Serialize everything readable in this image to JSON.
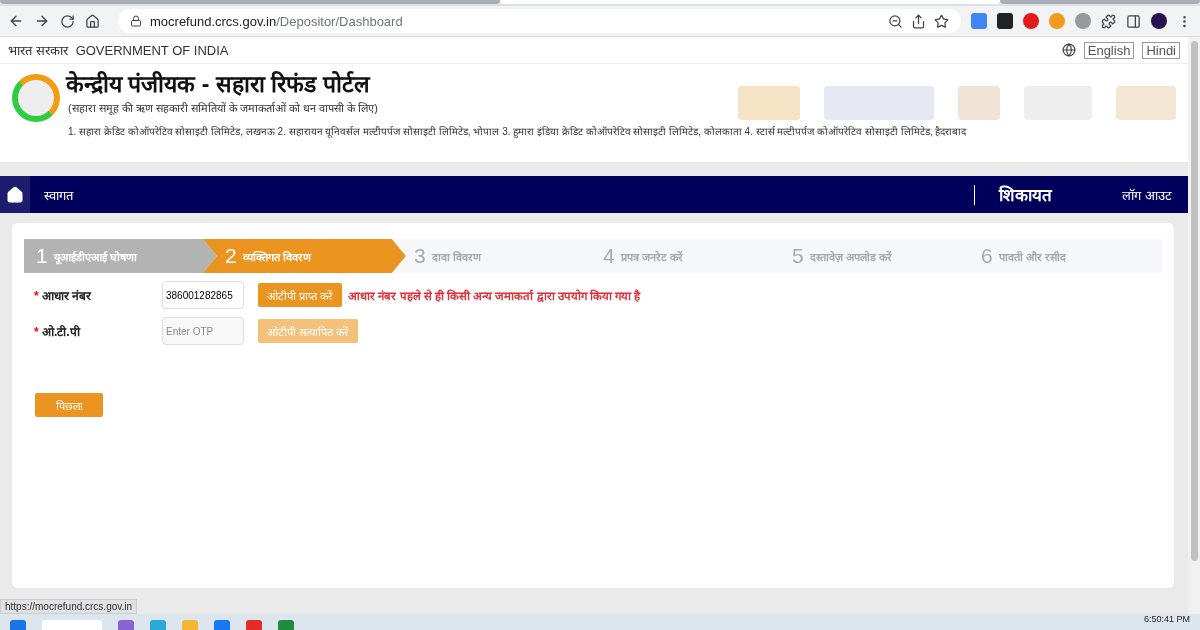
{
  "browser": {
    "url_host": "mocrefund.crcs.gov.in",
    "url_path": "/Depositor/Dashboard"
  },
  "gov_bar": {
    "hindi": "भारत सरकार",
    "english": "GOVERNMENT OF INDIA",
    "languages": [
      "English",
      "Hindi"
    ]
  },
  "header": {
    "title": "केन्द्रीय पंजीयक - सहारा रिफंड पोर्टल",
    "subtitle": "(सहारा समूह की ऋण सहकारी समितियों के जमाकर्ताओं को धन वापसी के लिए)",
    "societies": "1. सहारा क्रेडिट कोऑपरेटिव सोसाइटी लिमिटेड, लखनऊ  2. सहारायन यूनिवर्सल मल्टीपर्पज सोसाइटी लिमिटेड, भोपाल  3. हुमारा इंडिया क्रेडिट कोऑपरेटिव सोसाइटी लिमिटेड, कोलकाता  4. स्टार्स मल्टीपर्पज कोऑपरेटिव सोसाइटी लिमिटेड, हैदराबाद"
  },
  "nav": {
    "welcome": "स्वागत",
    "complaint": "शिकायत",
    "logout": "लॉग आउट"
  },
  "steps": [
    {
      "number": "1",
      "label": "यूआईडीएआई घोषणा",
      "completed": true,
      "selected": false
    },
    {
      "number": "2",
      "label": "व्यक्तिगत विवरण",
      "completed": false,
      "selected": true
    },
    {
      "number": "3",
      "label": "दावा विवरण",
      "completed": false,
      "selected": false
    },
    {
      "number": "4",
      "label": "प्रपत्र जनरेट करें",
      "completed": false,
      "selected": false
    },
    {
      "number": "5",
      "label": "दस्तावेज़ अपलोड करें",
      "completed": false,
      "selected": false
    },
    {
      "number": "6",
      "label": "पावती और रसीद",
      "completed": false,
      "selected": false
    }
  ],
  "form": [
    {
      "required_mark": "*",
      "label": "आधार नंबर",
      "value": "386001282865",
      "button": "ओटीपी प्राप्त करें",
      "disabled": false,
      "error": "आधार नंबर पहले से ही किसी अन्य जमाकर्ता द्वारा उपयोग किया गया है"
    },
    {
      "required_mark": "*",
      "label": "ओ.टी.पी",
      "placeholder": "Enter OTP",
      "button": "ओटीपी सत्यापित करें",
      "disabled": true
    }
  ],
  "back_button": "पिछला",
  "status_url": "https://mocrefund.crcs.gov.in",
  "taskbar": {
    "time": "6:50:41 PM"
  }
}
